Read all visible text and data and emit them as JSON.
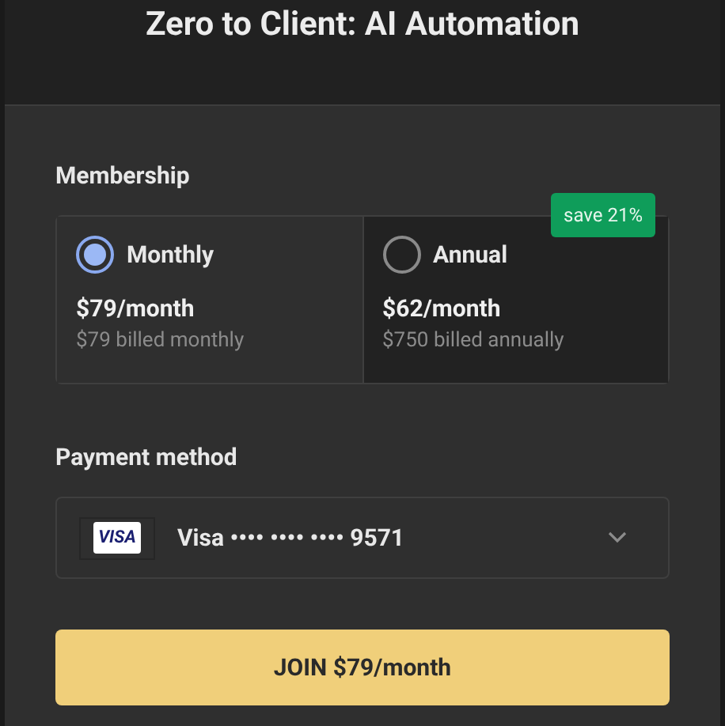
{
  "title": "Zero to Client: AI Automation",
  "membership": {
    "label": "Membership",
    "plans": [
      {
        "name": "Monthly",
        "price": "$79/month",
        "billing": "$79 billed monthly",
        "selected": true
      },
      {
        "name": "Annual",
        "price": "$62/month",
        "billing": "$750 billed annually",
        "selected": false,
        "badge": "save 21%"
      }
    ]
  },
  "payment": {
    "label": "Payment method",
    "card_brand": "VISA",
    "card_text": "Visa •••• •••• •••• 9571"
  },
  "join_button": "JOIN $79/month"
}
